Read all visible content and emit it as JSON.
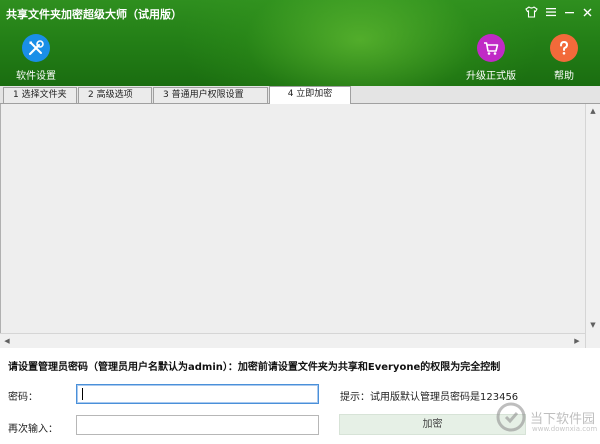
{
  "window": {
    "title": "共享文件夹加密超级大师（试用版）",
    "controls": {
      "skin": "shirt-icon",
      "menu": "menu-icon",
      "minimize": "—",
      "close": "×"
    }
  },
  "toolbar": {
    "settings_label": "软件设置",
    "upgrade_label": "升级正式版",
    "help_label": "帮助"
  },
  "colors": {
    "header_green": "#248017",
    "settings_icon": "#1a8fe8",
    "upgrade_icon": "#c02ac6",
    "help_icon": "#f26a3a"
  },
  "tabs": [
    {
      "label": "1 选择文件夹",
      "active": false
    },
    {
      "label": "2 高级选项",
      "active": false
    },
    {
      "label": "3 普通用户权限设置",
      "active": false
    },
    {
      "label": "4 立即加密",
      "active": true
    }
  ],
  "form": {
    "notice": "请设置管理员密码（管理员用户名默认为admin）：加密前请设置文件夹为共享和Everyone的权限为完全控制",
    "password_label": "密码：",
    "password_value": "",
    "confirm_label": "再次输入：",
    "confirm_value": "",
    "hint": "提示：试用版默认管理员密码是123456",
    "encrypt_label": "加密"
  },
  "watermark": {
    "text": "当下软件园",
    "sub": "www.downxia.com"
  }
}
